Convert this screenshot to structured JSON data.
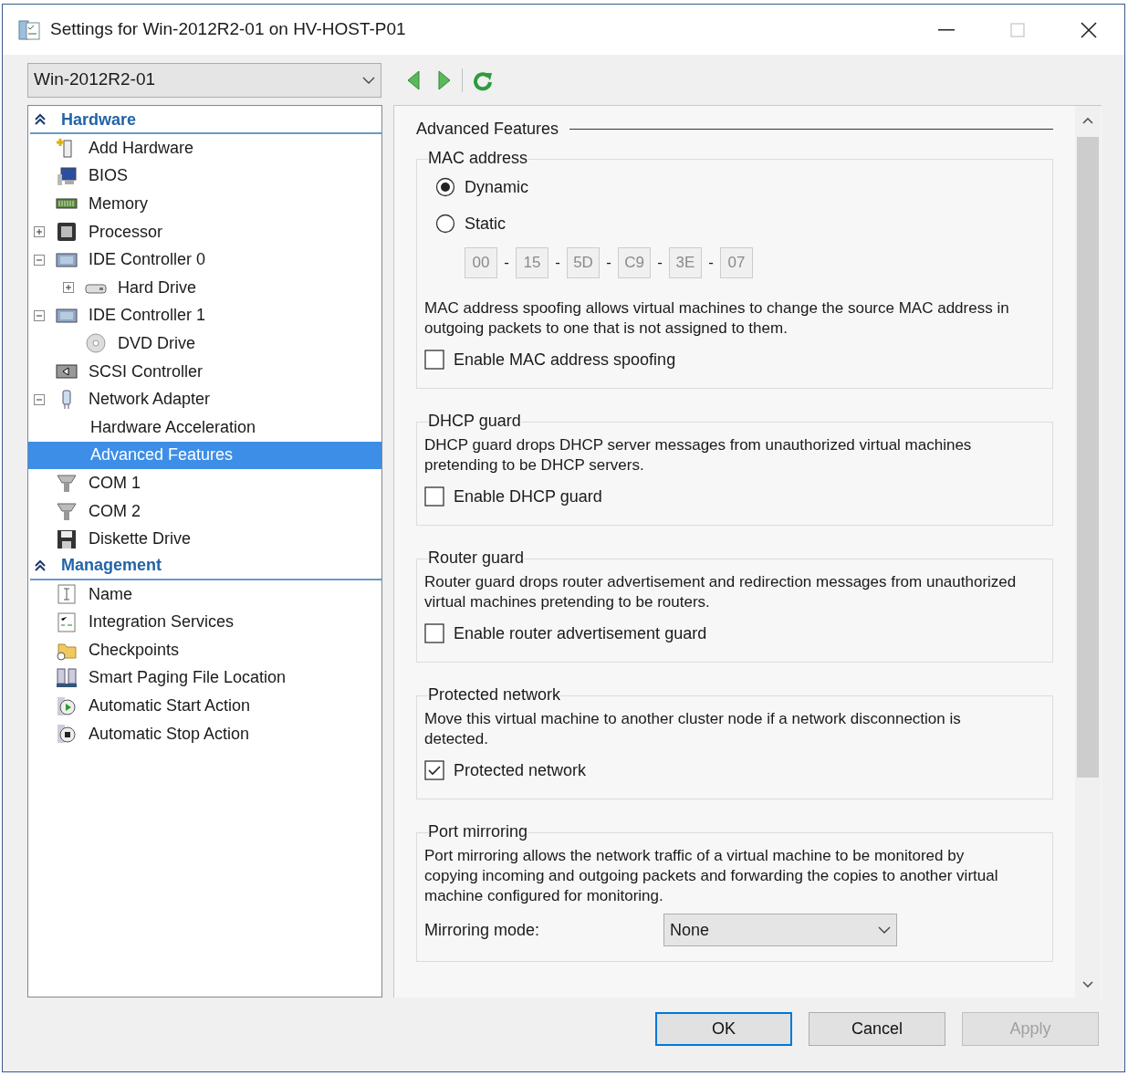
{
  "window": {
    "title": "Settings for Win-2012R2-01 on HV-HOST-P01",
    "maximize_disabled": true
  },
  "vm_selector": {
    "value": "Win-2012R2-01"
  },
  "sidebar": {
    "sections": [
      {
        "title": "Hardware",
        "expanded": true,
        "items": [
          {
            "label": "Add Hardware",
            "kind": "add",
            "selected": false
          },
          {
            "label": "BIOS",
            "kind": "bios",
            "selected": false
          },
          {
            "label": "Memory",
            "kind": "memory",
            "selected": false
          },
          {
            "label": "Processor",
            "kind": "processor",
            "selected": false,
            "expanded": false
          },
          {
            "label": "IDE Controller 0",
            "kind": "controller",
            "selected": false,
            "expanded": true,
            "children": [
              {
                "label": "Hard Drive",
                "kind": "disk",
                "selected": false,
                "expanded": false
              }
            ]
          },
          {
            "label": "IDE Controller 1",
            "kind": "controller",
            "selected": false,
            "expanded": true,
            "children": [
              {
                "label": "DVD Drive",
                "kind": "dvd",
                "selected": false
              }
            ]
          },
          {
            "label": "SCSI Controller",
            "kind": "scsi",
            "selected": false
          },
          {
            "label": "Network Adapter",
            "kind": "network",
            "selected": false,
            "expanded": true,
            "children": [
              {
                "label": "Hardware Acceleration",
                "kind": "setting",
                "selected": false
              },
              {
                "label": "Advanced Features",
                "kind": "setting",
                "selected": true
              }
            ]
          },
          {
            "label": "COM 1",
            "kind": "port",
            "selected": false
          },
          {
            "label": "COM 2",
            "kind": "port",
            "selected": false
          },
          {
            "label": "Diskette Drive",
            "kind": "floppy",
            "selected": false
          }
        ]
      },
      {
        "title": "Management",
        "expanded": true,
        "items": [
          {
            "label": "Name",
            "kind": "name",
            "selected": false
          },
          {
            "label": "Integration Services",
            "kind": "checklist",
            "selected": false
          },
          {
            "label": "Checkpoints",
            "kind": "folder",
            "selected": false
          },
          {
            "label": "Smart Paging File Location",
            "kind": "paging",
            "selected": false
          },
          {
            "label": "Automatic Start Action",
            "kind": "start",
            "selected": false
          },
          {
            "label": "Automatic Stop Action",
            "kind": "stop",
            "selected": false
          }
        ]
      }
    ]
  },
  "content": {
    "heading": "Advanced Features",
    "groups": [
      {
        "title": "MAC address",
        "controls": [
          {
            "kind": "radio",
            "label": "Dynamic",
            "selected": true
          },
          {
            "kind": "radio",
            "label": "Static",
            "selected": false
          },
          {
            "kind": "mac",
            "disabled": true,
            "separator": "-",
            "octets": [
              "00",
              "15",
              "5D",
              "C9",
              "3E",
              "07"
            ]
          },
          {
            "kind": "text",
            "text": "MAC address spoofing allows virtual machines to change the source MAC address in outgoing packets to one that is not assigned to them."
          },
          {
            "kind": "checkbox",
            "label": "Enable MAC address spoofing",
            "checked": false
          }
        ]
      },
      {
        "title": "DHCP guard",
        "controls": [
          {
            "kind": "text",
            "text": "DHCP guard drops DHCP server messages from unauthorized virtual machines pretending to be DHCP servers."
          },
          {
            "kind": "checkbox",
            "label": "Enable DHCP guard",
            "checked": false
          }
        ]
      },
      {
        "title": "Router guard",
        "controls": [
          {
            "kind": "text",
            "text": "Router guard drops router advertisement and redirection messages from unauthorized virtual machines pretending to be routers."
          },
          {
            "kind": "checkbox",
            "label": "Enable router advertisement guard",
            "checked": false
          }
        ]
      },
      {
        "title": "Protected network",
        "controls": [
          {
            "kind": "text",
            "text": "Move this virtual machine to another cluster node if a network disconnection is detected."
          },
          {
            "kind": "checkbox",
            "label": "Protected network",
            "checked": true
          }
        ]
      },
      {
        "title": "Port mirroring",
        "controls": [
          {
            "kind": "text",
            "text": "Port mirroring allows the network traffic of a virtual machine to be monitored by copying incoming and outgoing packets and forwarding the copies to another virtual machine configured for monitoring."
          },
          {
            "kind": "select",
            "label": "Mirroring mode:",
            "value": "None"
          }
        ]
      }
    ]
  },
  "buttons": [
    {
      "label": "OK",
      "default": true,
      "disabled": false
    },
    {
      "label": "Cancel",
      "default": false,
      "disabled": false
    },
    {
      "label": "Apply",
      "default": false,
      "disabled": true
    }
  ]
}
